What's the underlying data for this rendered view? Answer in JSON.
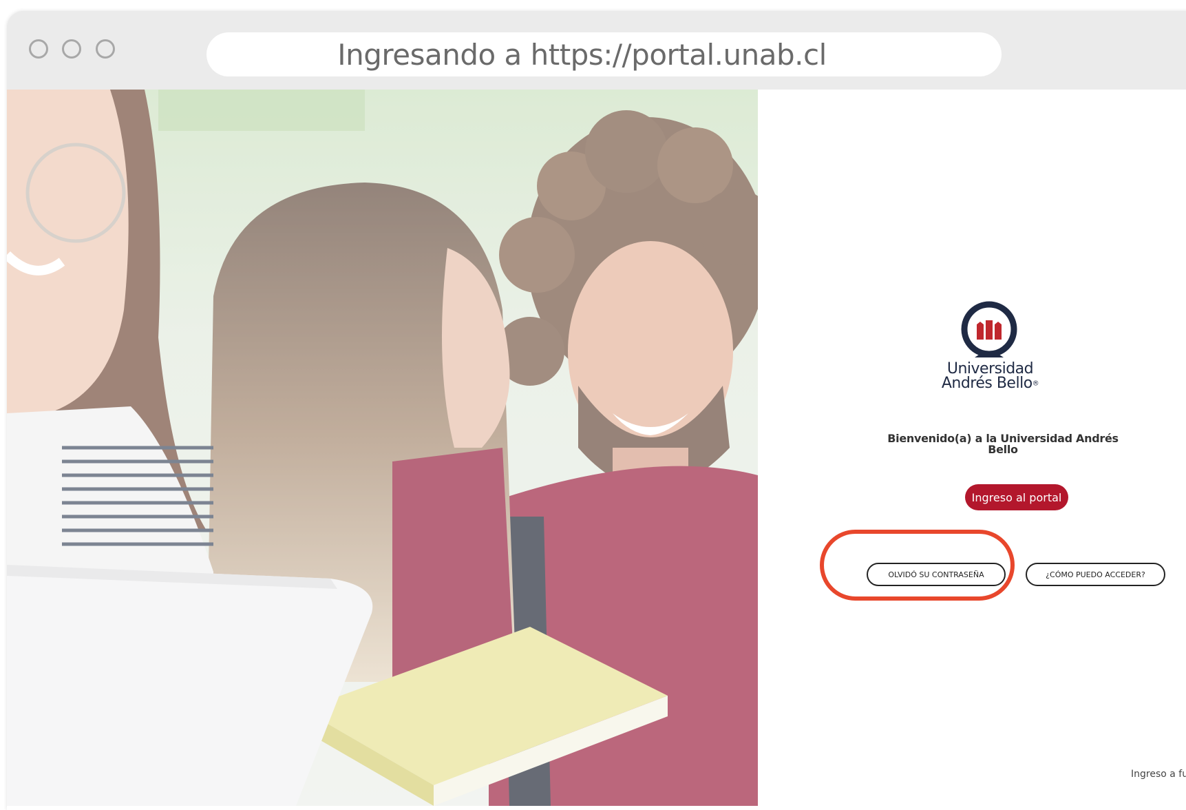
{
  "browser": {
    "address_bar": "Ingresando a https://portal.unab.cl"
  },
  "login": {
    "logo_line1": "Universidad",
    "logo_line2": "Andrés Bello",
    "logo_mark": "®",
    "welcome": "Bienvenido(a) a la Universidad Andrés Bello",
    "portal_button": "Ingreso al portal",
    "forgot_button": "OLVIDÓ SU CONTRASEÑA",
    "access_button": "¿CÓMO PUEDO ACCEDER?",
    "footer_link": "Ingreso a func"
  },
  "colors": {
    "brand_red": "#b3172c",
    "logo_navy": "#1f2a44",
    "highlight": "#e8472c"
  },
  "icons": {
    "logo": "university-seal-icon",
    "window_controls": [
      "window-close-icon",
      "window-minimize-icon",
      "window-maximize-icon"
    ]
  }
}
